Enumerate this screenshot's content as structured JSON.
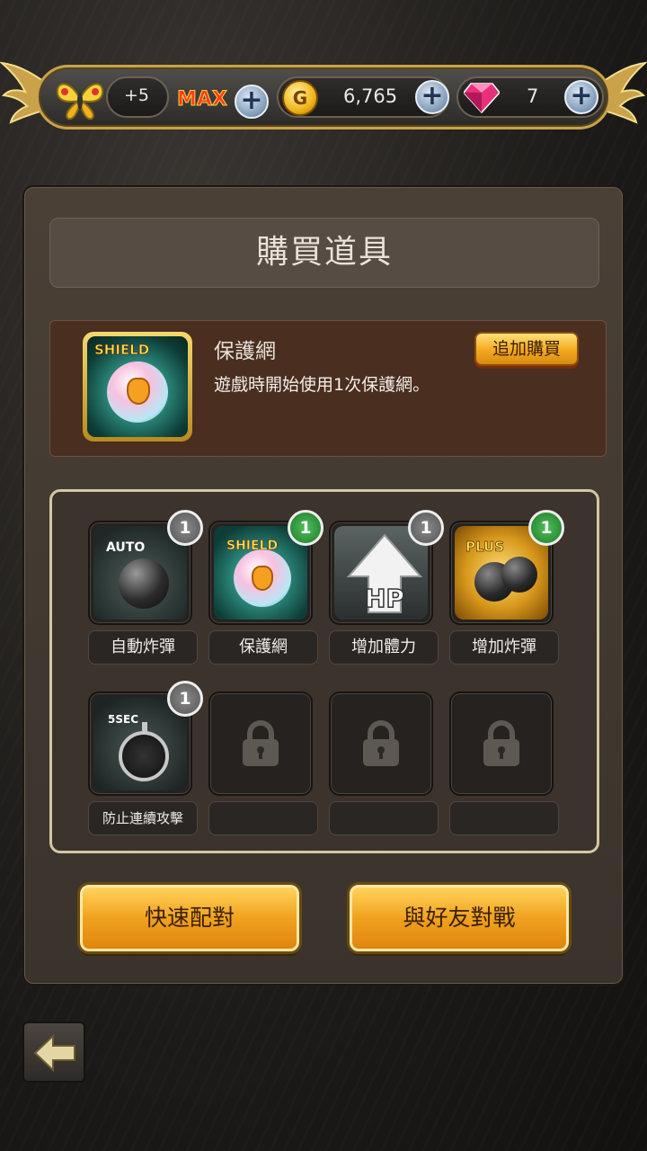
{
  "topbar": {
    "energy_plus": "+5",
    "energy_max": "MAX",
    "gold_icon_letter": "G",
    "gold": "6,765",
    "gems": "7",
    "add_glyph": "+"
  },
  "panel": {
    "title": "購買道具"
  },
  "selected_item": {
    "icon_text": "SHIELD",
    "name": "保護網",
    "description": "遊戲時開始使用1次保護網。",
    "buy_label": "追加購買"
  },
  "slots": [
    {
      "label": "自動炸彈",
      "count": "1",
      "badge_color": "gray",
      "icon_text": "AUTO",
      "icon": "auto-bomb-icon"
    },
    {
      "label": "保護網",
      "count": "1",
      "badge_color": "green",
      "icon_text": "SHIELD",
      "icon": "shield-icon"
    },
    {
      "label": "增加體力",
      "count": "1",
      "badge_color": "gray",
      "icon_text": "HP",
      "icon": "hp-up-icon"
    },
    {
      "label": "增加炸彈",
      "count": "1",
      "badge_color": "green",
      "icon_text": "PLUS",
      "icon": "bomb-plus-icon"
    },
    {
      "label": "防止連續攻擊",
      "count": "1",
      "badge_color": "gray",
      "icon_text": "5SEC",
      "icon": "stopwatch-icon"
    },
    {
      "label": "",
      "locked": true,
      "icon": "lock-icon"
    },
    {
      "label": "",
      "locked": true,
      "icon": "lock-icon"
    },
    {
      "label": "",
      "locked": true,
      "icon": "lock-icon"
    }
  ],
  "buttons": {
    "quick_match": "快速配對",
    "friend_battle": "與好友對戰"
  },
  "colors": {
    "accent_gold": "#f0a21f",
    "badge_green": "#1e7a2a",
    "badge_gray": "#555555"
  }
}
